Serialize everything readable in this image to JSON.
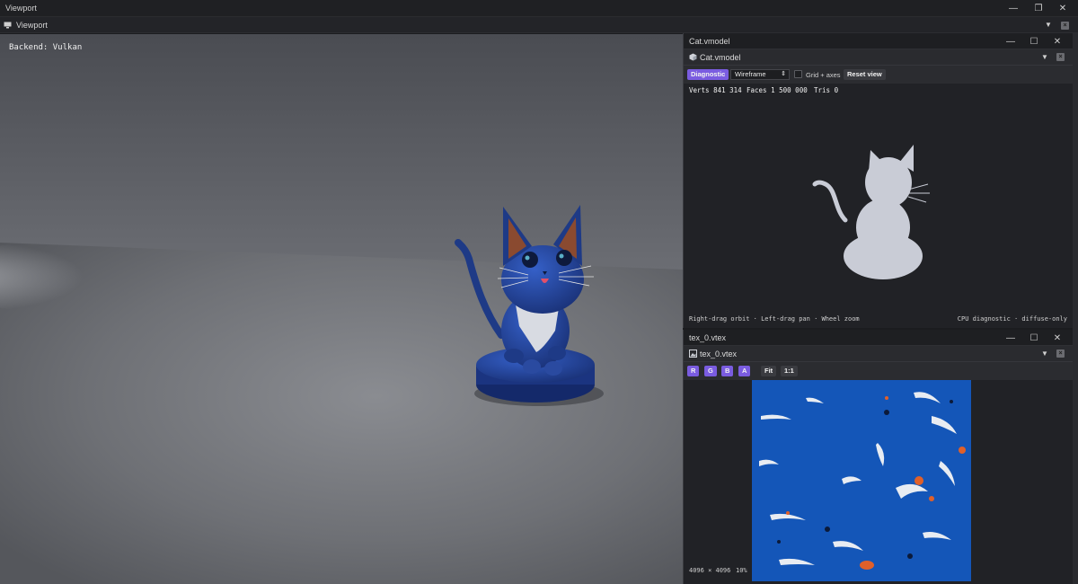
{
  "window": {
    "title": "Viewport",
    "controls": {
      "minimize_glyph": "—",
      "restore_glyph": "❐",
      "close_glyph": "✕"
    }
  },
  "viewport_tab": {
    "label": "Viewport",
    "icon": "monitor-icon"
  },
  "scene": {
    "backend_label": "Backend: Vulkan",
    "colors": {
      "cat_body": "#1e3a86",
      "ears_inner": "#8a4a30",
      "bib": "#d8dbe2",
      "tongue": "#e2506a"
    }
  },
  "model_panel": {
    "title": "Cat.vmodel",
    "tab_label": "Cat.vmodel",
    "toolbar": {
      "mode_button": "Diagnostic",
      "render_select": "Wireframe",
      "grid_checkbox_label": "Grid + axes",
      "reset_button": "Reset view"
    },
    "stats": {
      "verts": "Verts 841 314",
      "faces": "Faces 1 500 000",
      "tris": "Tris 0"
    },
    "footer_left": "Right-drag orbit · Left-drag pan · Wheel zoom",
    "footer_right": "CPU diagnostic · diffuse-only",
    "silhouette_color": "#c9ccd6"
  },
  "texture_panel": {
    "title": "tex_0.vtex",
    "tab_label": "tex_0.vtex",
    "channels": [
      "R",
      "G",
      "B",
      "A"
    ],
    "fit_button": "Fit",
    "one_to_one_button": "1:1",
    "dimensions": "4096 × 4096",
    "zoom": "10%",
    "texture_colors": {
      "base": "#1456b8",
      "highlight": "#e8ecf2",
      "accent": "#e0602a"
    }
  }
}
